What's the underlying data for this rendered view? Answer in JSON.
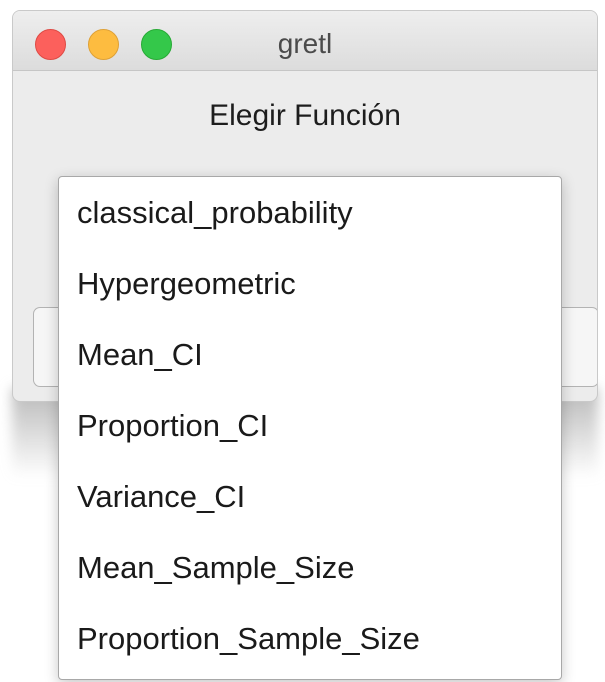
{
  "window": {
    "title": "gretl"
  },
  "dialog": {
    "heading": "Elegir Función"
  },
  "function_list": {
    "items": [
      "classical_probability",
      "Hypergeometric",
      "Mean_CI",
      "Proportion_CI",
      "Variance_CI",
      "Mean_Sample_Size",
      "Proportion_Sample_Size"
    ]
  },
  "colors": {
    "close": "#fc605c",
    "minimize": "#fdbc40",
    "zoom": "#34c84a"
  }
}
